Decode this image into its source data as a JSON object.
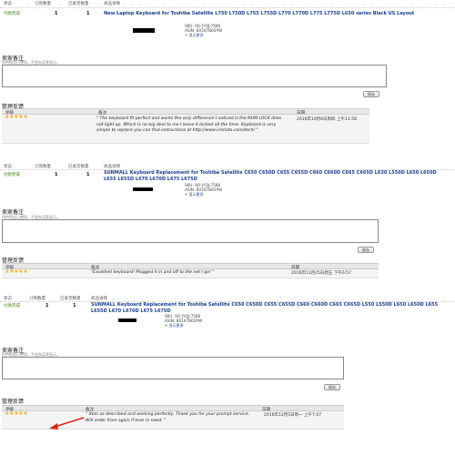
{
  "orders": [
    {
      "headers": {
        "status": "状态",
        "ordered": "订购数量",
        "shipped": "已发货数量",
        "details": "商品详情"
      },
      "status": "付款完成",
      "qty_ordered": "1",
      "qty_shipped": "1",
      "title": "New Laptop Keyboard for Toshiba Satellite L750 L750D L755 L755D L770 L770D L775 L775D L650 series Black US Layout",
      "sku": "SKU: 9O-JYQJ-7586",
      "asin": "ASIN: B01K7B65PW",
      "more": "+ 显示更多",
      "note_title": "卖家备注",
      "note_hint": "仅供您自己使用，不会向买家显示。",
      "save": "保存",
      "feedback_title": "管理反馈",
      "fb_headers": {
        "rating": "评级",
        "comment": "备注",
        "date": "日期"
      },
      "rating": "★★★★★",
      "comment": "\" The keyboard fit perfect and works the only difference I noticed is the NUM LOCK does not light up. Which is no big deal to me I leave it locked all the time. Keyboard is very simple to replace you can find instructions at http://www.irisrlate.com/tech/ \"",
      "date": "2016年10月6日周四 上午11:58"
    },
    {
      "headers": {
        "status": "状态",
        "ordered": "订购数量",
        "shipped": "已发货数量",
        "details": "商品详情"
      },
      "status": "付款完成",
      "qty_ordered": "1",
      "qty_shipped": "1",
      "title": "SUNMALL Keyboard Replacement for Toshiba Satellite C650 C650D C655 C655D C660 C660D C665 C665D L630 L550D L650 L650D L655 L655D L670 L670D L675 L675D",
      "sku": "SKU: 9O-JYQJ-7586",
      "asin": "ASIN: B01K7B65PW",
      "more": "+ 显示更多",
      "note_title": "卖家备注",
      "note_hint": "仅供您自己使用，不会向买家显示。",
      "save": "保存",
      "feedback_title": "管理反馈",
      "fb_headers": {
        "rating": "评级",
        "comment": "备注",
        "date": "日期"
      },
      "rating": "★★★★★",
      "comment": "\"Excellent keyboard! Plugged it in and off to the net I go! \"",
      "date": "2016年11月25日周五 下午6:57"
    },
    {
      "headers": {
        "status": "状态",
        "ordered": "订购数量",
        "shipped": "已发货数量",
        "details": "商品详情"
      },
      "status": "付款完成",
      "qty_ordered": "1",
      "qty_shipped": "1",
      "title": "SUNMALL Keyboard Replacement for Toshiba Satellite C650 C650D C655 C655D C660 C660D C665 C665D L550 L550D L650 L650D L655 L655D L670 L670D L675 L675D",
      "sku": "SKU: 9O-JYQJ-7586",
      "asin": "ASIN: B01K7B65PW",
      "more": "+ 显示更多",
      "note_title": "卖家备注",
      "note_hint": "仅供您自己使用，不会向买家显示。",
      "save": "保存",
      "feedback_title": "管理反馈",
      "fb_headers": {
        "rating": "评级",
        "comment": "备注",
        "date": "日期"
      },
      "rating": "★★★★★",
      "comment": "\" Item as described and working perfectly. Thank you for your prompt service. Will order from again if ever in need. \"",
      "date": "2016年12月5日周一 上午7:07"
    }
  ],
  "colors": {
    "status_green": "#3a7d1a",
    "title_blue": "#1b3f92",
    "star_gold": "#f2b01e",
    "arrow_red": "#e0251b"
  }
}
